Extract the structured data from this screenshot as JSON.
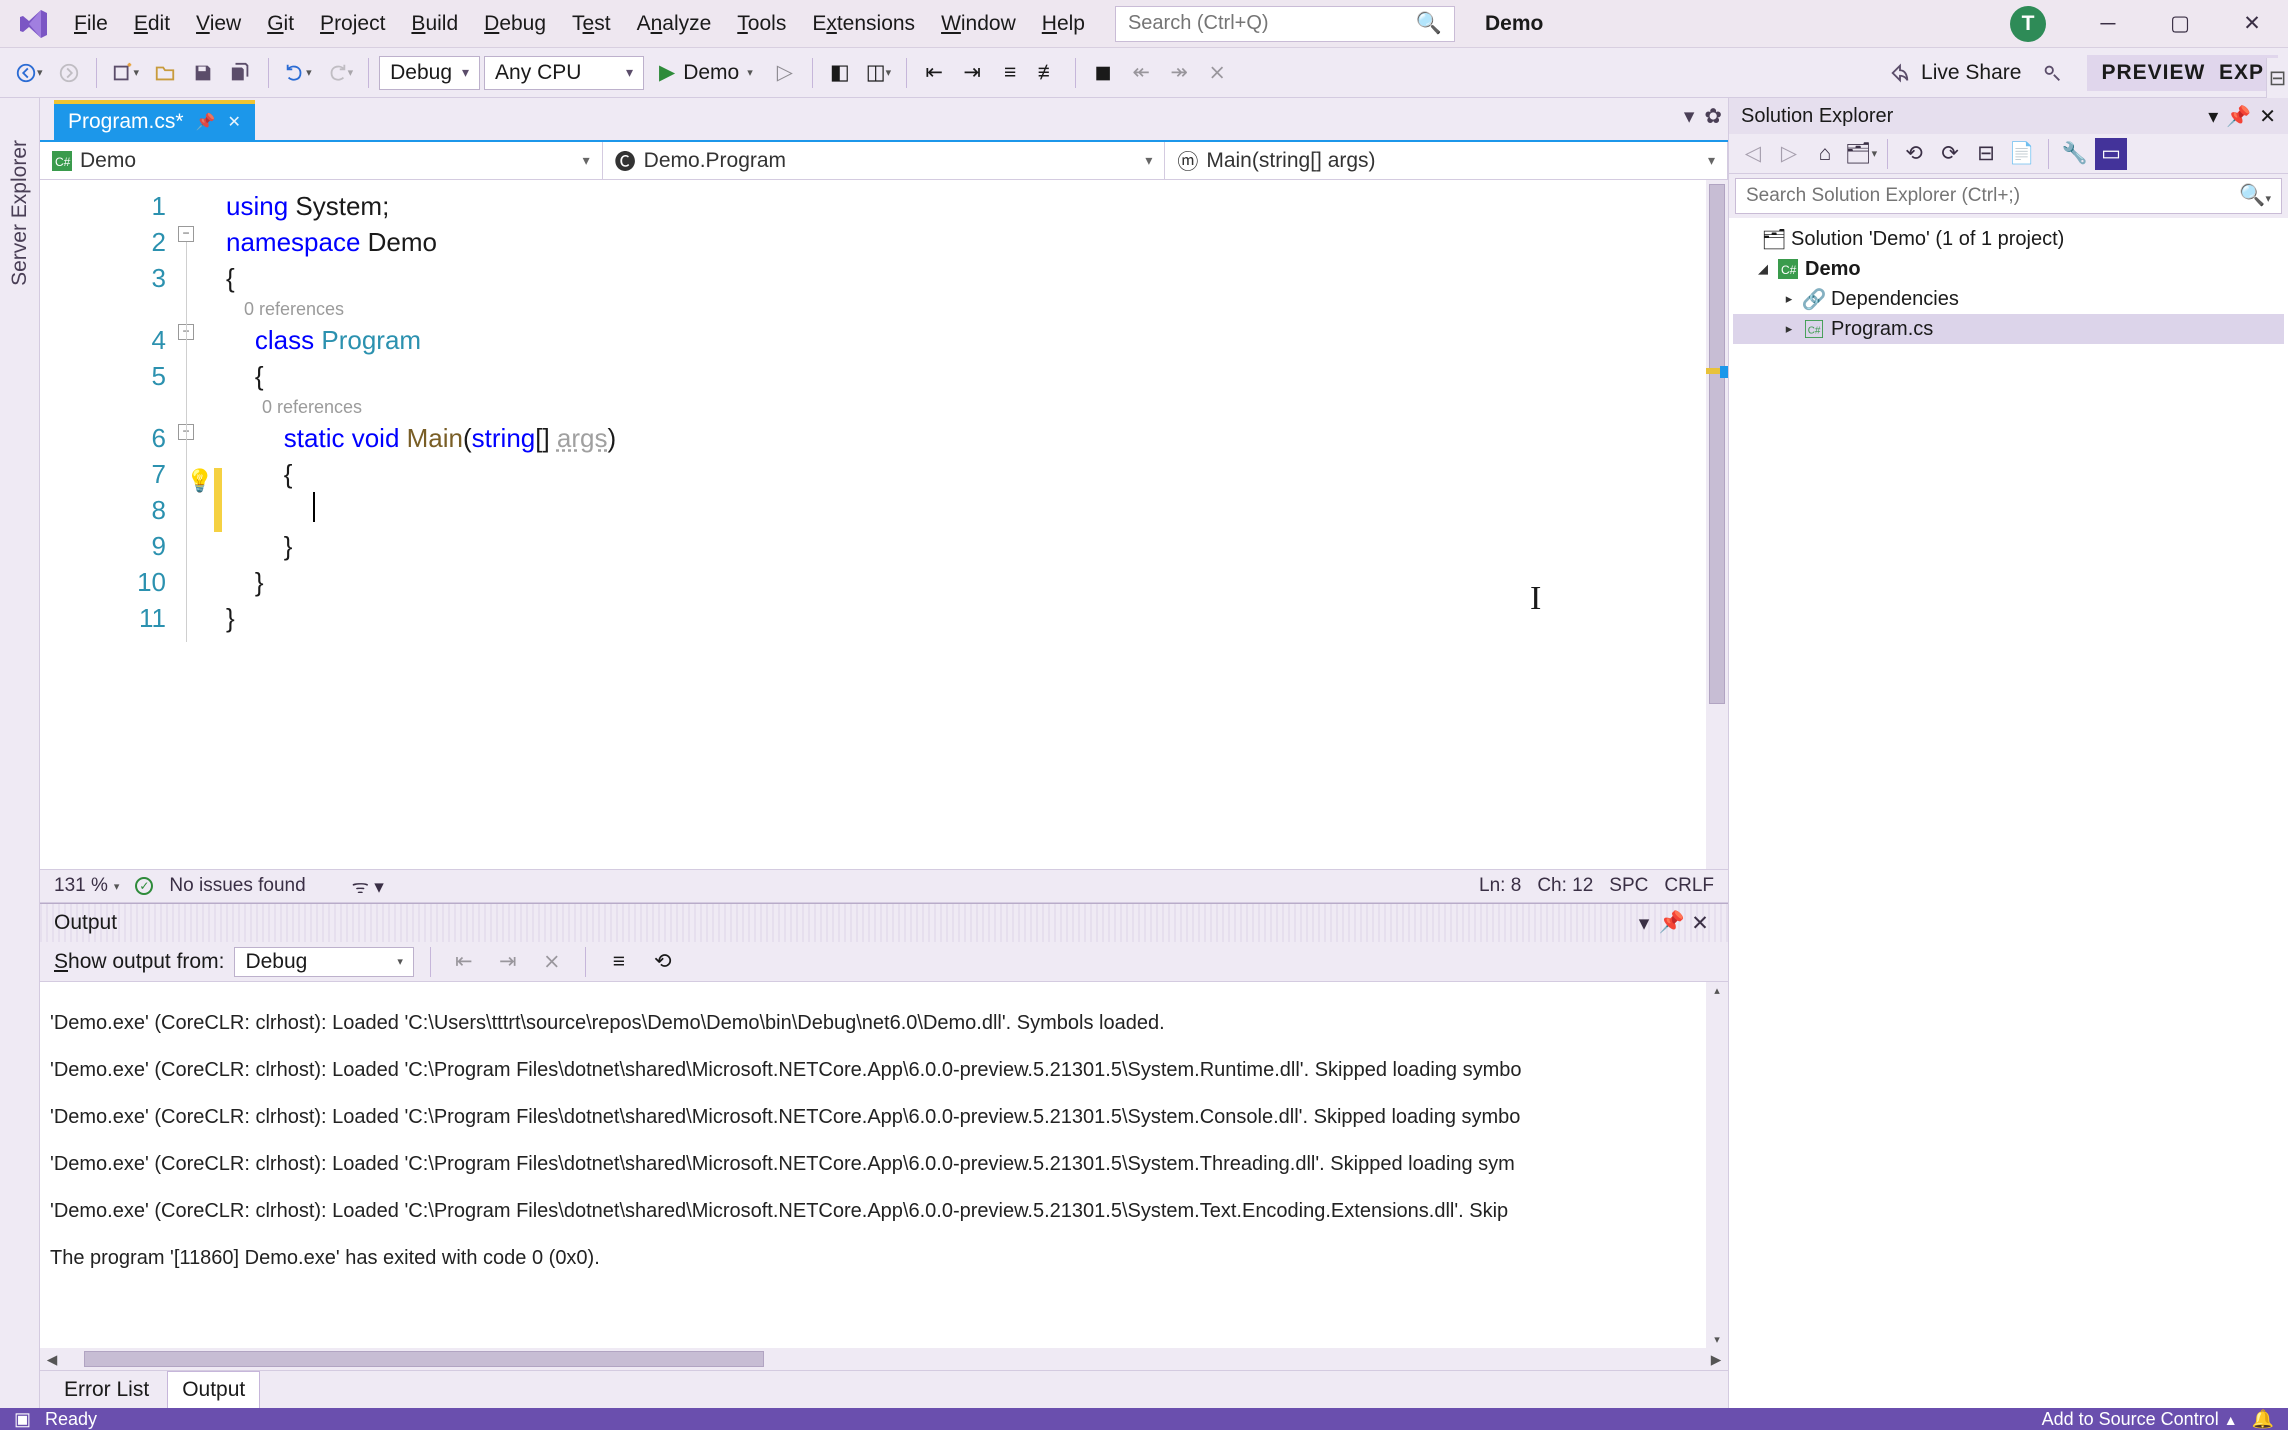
{
  "menu": {
    "file": "File",
    "edit": "Edit",
    "view": "View",
    "git": "Git",
    "project": "Project",
    "build": "Build",
    "debug": "Debug",
    "test": "Test",
    "analyze": "Analyze",
    "tools": "Tools",
    "extensions": "Extensions",
    "window": "Window",
    "help": "Help"
  },
  "search_placeholder": "Search (Ctrl+Q)",
  "solution_name_title": "Demo",
  "user_initial": "T",
  "toolbar": {
    "config": "Debug",
    "platform": "Any CPU",
    "run_target": "Demo",
    "live_share": "Live Share",
    "preview": "PREVIEW",
    "exp": "EXP"
  },
  "doc_tab": {
    "name": "Program.cs*"
  },
  "nav": {
    "project": "Demo",
    "type": "Demo.Program",
    "member": "Main(string[] args)"
  },
  "code": {
    "l1_using": "using",
    "l1_ns": " System;",
    "l2_kw": "namespace",
    "l2_name": " Demo",
    "l3": "{",
    "ref0": "0 references",
    "l4_kw": "class",
    "l4_name": " Program",
    "l5": "{",
    "ref1": "0 references",
    "l6_static": "static",
    "l6_void": " void",
    "l6_main": " Main",
    "l6_open": "(",
    "l6_str": "string",
    "l6_br": "[]",
    "l6_sp": " ",
    "l6_args": "args",
    "l6_close": ")",
    "l7": "{",
    "l8": "",
    "l9": "}",
    "l10": "}",
    "l11": "}"
  },
  "line_numbers": [
    "1",
    "2",
    "3",
    "4",
    "5",
    "6",
    "7",
    "8",
    "9",
    "10",
    "11"
  ],
  "editor_status": {
    "zoom": "131 %",
    "issues": "No issues found",
    "pos": "Ln: 8",
    "col": "Ch: 12",
    "ws": "SPC",
    "eol": "CRLF"
  },
  "output": {
    "title": "Output",
    "show_from_label": "Show output from:",
    "show_from_value": "Debug",
    "lines": [
      "'Demo.exe' (CoreCLR: clrhost): Loaded 'C:\\Users\\tttrt\\source\\repos\\Demo\\Demo\\bin\\Debug\\net6.0\\Demo.dll'. Symbols loaded.",
      "'Demo.exe' (CoreCLR: clrhost): Loaded 'C:\\Program Files\\dotnet\\shared\\Microsoft.NETCore.App\\6.0.0-preview.5.21301.5\\System.Runtime.dll'. Skipped loading symbo",
      "'Demo.exe' (CoreCLR: clrhost): Loaded 'C:\\Program Files\\dotnet\\shared\\Microsoft.NETCore.App\\6.0.0-preview.5.21301.5\\System.Console.dll'. Skipped loading symbo",
      "'Demo.exe' (CoreCLR: clrhost): Loaded 'C:\\Program Files\\dotnet\\shared\\Microsoft.NETCore.App\\6.0.0-preview.5.21301.5\\System.Threading.dll'. Skipped loading sym",
      "'Demo.exe' (CoreCLR: clrhost): Loaded 'C:\\Program Files\\dotnet\\shared\\Microsoft.NETCore.App\\6.0.0-preview.5.21301.5\\System.Text.Encoding.Extensions.dll'. Skip",
      "The program '[11860] Demo.exe' has exited with code 0 (0x0)."
    ]
  },
  "well_tabs": {
    "error_list": "Error List",
    "output": "Output"
  },
  "solution_explorer": {
    "title": "Solution Explorer",
    "search_placeholder": "Search Solution Explorer (Ctrl+;)",
    "root": "Solution 'Demo' (1 of 1 project)",
    "project": "Demo",
    "deps": "Dependencies",
    "file": "Program.cs"
  },
  "statusbar": {
    "ready": "Ready",
    "add_source": "Add to Source Control"
  },
  "left_dock": {
    "server_explorer": "Server Explorer"
  }
}
